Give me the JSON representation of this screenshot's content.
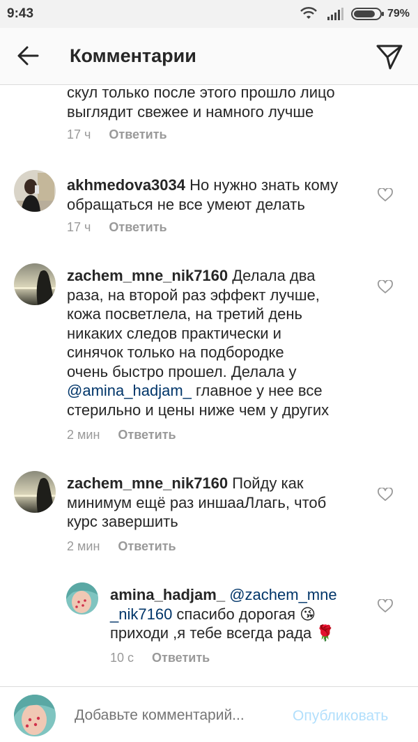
{
  "status_bar": {
    "time": "9:43",
    "battery": "79%"
  },
  "app_bar": {
    "title": "Комментарии"
  },
  "comments": [
    {
      "lines": [
        "скул только после этого прошло лицо",
        "выглядит свежее и намного лучше"
      ],
      "time": "17 ч",
      "reply_label": "Ответить"
    },
    {
      "username": "akhmedova3034",
      "first_line_rest": " Но нужно знать кому",
      "lines": [
        "обращаться не все умеют делать"
      ],
      "time": "17 ч",
      "reply_label": "Ответить"
    },
    {
      "username": "zachem_mne_nik7160",
      "first_line_rest": " Делала два",
      "lines": [
        "раза, на второй раз эффект лучше,",
        "кожа посветлела, на третий день",
        "никаких следов практически и",
        "синячок только на подбородке",
        "очень быстро прошел. Делала у"
      ],
      "mention": "@amina_hadjam_",
      "mention_rest": "  главное у нее  все",
      "last_line": "стерильно и цены ниже чем у других",
      "time": "2 мин",
      "reply_label": "Ответить"
    },
    {
      "username": "zachem_mne_nik7160",
      "first_line_rest": " Пойду как",
      "lines": [
        "минимум ещё раз иншааЛлагь, чтоб",
        "курс завершить"
      ],
      "time": "2 мин",
      "reply_label": "Ответить"
    },
    {
      "username": "amina_hadjam_",
      "mention_part1": "@zachem_mne",
      "mention_part2": "_nik7160",
      "line2_rest": "  спасибо дорогая 😘",
      "line3": "приходи ,я тебе всегда рада 🌹",
      "time": "10 с",
      "reply_label": "Ответить"
    }
  ],
  "composer": {
    "placeholder": "Добавьте комментарий...",
    "publish_label": "Опубликовать"
  },
  "colors": {
    "mention": "#003569",
    "publish": "#b2dffc",
    "meta": "#999999"
  }
}
